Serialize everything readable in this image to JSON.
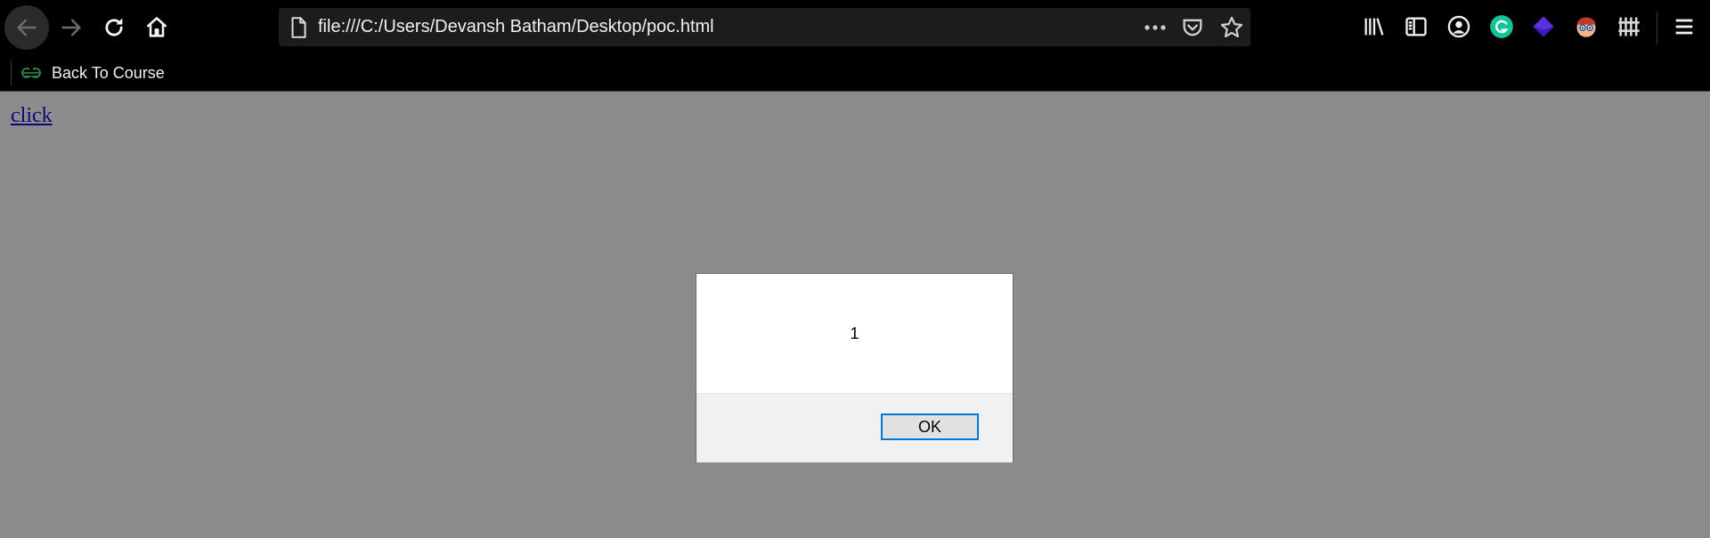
{
  "toolbar": {
    "url": "file:///C:/Users/Devansh Batham/Desktop/poc.html",
    "icons": {
      "back": "back-arrow-icon",
      "forward": "forward-arrow-icon",
      "reload": "reload-icon",
      "home": "home-icon",
      "page": "page-icon",
      "more": "more-dots-icon",
      "pocket": "pocket-icon",
      "star": "bookmark-star-icon",
      "library": "library-icon",
      "sidebar": "sidebar-icon",
      "account": "account-icon",
      "grammarly": "grammarly-icon",
      "extension_purple": "extension-layers-icon",
      "extension_face": "extension-face-icon",
      "extension_bars": "extension-bars-icon",
      "menu": "hamburger-menu-icon"
    }
  },
  "bookmarks": {
    "items": [
      {
        "label": "Back To Course",
        "icon": "gfg-logo-icon"
      }
    ]
  },
  "page": {
    "link_text": "click"
  },
  "dialog": {
    "message": "1",
    "ok_label": "OK"
  },
  "colors": {
    "chrome_bg": "#000000",
    "urlbar_bg": "#1c1c1c",
    "overlay_bg": "#8c8c8c",
    "ok_border": "#0078d7",
    "grammarly_green": "#15c39a",
    "gfg_green": "#2f8d46"
  }
}
